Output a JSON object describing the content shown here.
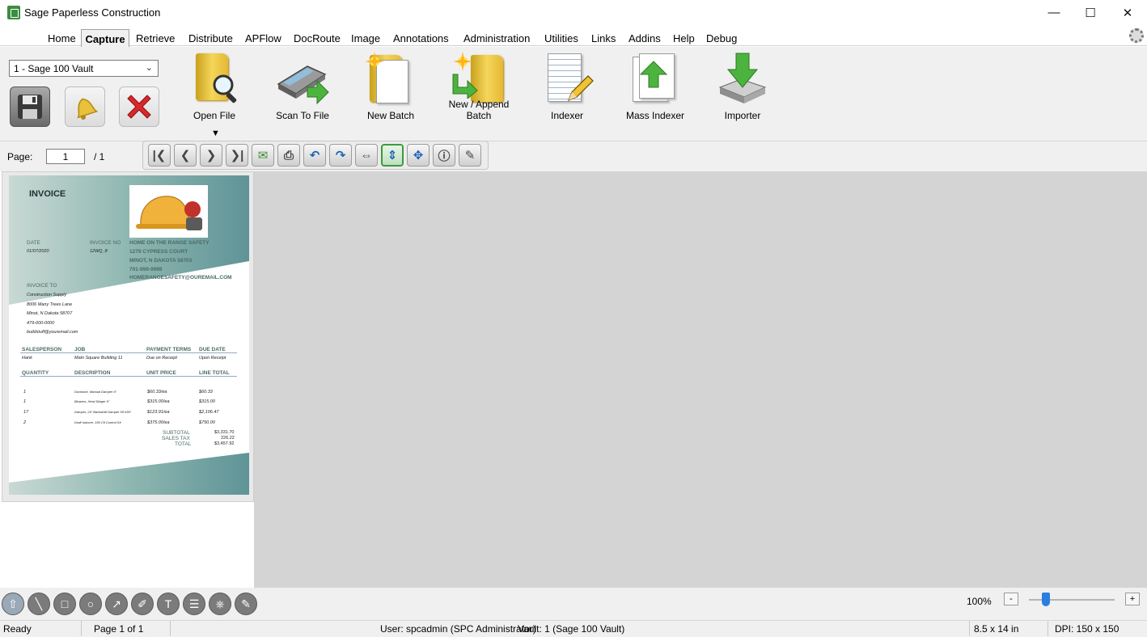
{
  "window": {
    "title": "Sage Paperless Construction",
    "minimize": "—",
    "maximize": "☐",
    "close": "✕"
  },
  "menu": [
    "Home",
    "Capture",
    "Retrieve",
    "Distribute",
    "APFlow",
    "DocRoute",
    "Image",
    "Annotations",
    "Administration",
    "Utilities",
    "Links",
    "Addins",
    "Help",
    "Debug"
  ],
  "ribbon": {
    "vault_select": "1 - Sage 100 Vault",
    "tools": {
      "open_file": "Open File",
      "scan_to_file": "Scan To File",
      "new_batch": "New Batch",
      "new_append_batch": "New / Append Batch",
      "indexer": "Indexer",
      "mass_indexer": "Mass Indexer",
      "importer": "Importer"
    },
    "dropdown_marker": "▼"
  },
  "pager": {
    "label": "Page:",
    "current": "1",
    "total": "/ 1"
  },
  "invoice": {
    "title": "INVOICE",
    "date_label": "DATE",
    "date_value": "01/07/2020",
    "invoice_no_label": "INVOICE NO",
    "invoice_no_value": "12WQ_8",
    "company": [
      "HOME ON THE RANGE SAFETY",
      "1279 CYPRESS COURT",
      "MINOT, N DAKOTA 58703",
      "701-999-9999",
      "HOMERANGESAFETY@OUREMAIL.COM"
    ],
    "invoice_to_label": "INVOICE TO",
    "bill_to": [
      "Construction Supply",
      "8006 Many Trees Lane",
      "Minot, N Dakota 58707",
      "479-000-0000",
      "buildstuff@youremail.com"
    ],
    "row1_headers": [
      "SALESPERSON",
      "JOB",
      "PAYMENT TERMS",
      "DUE DATE"
    ],
    "row1_values": [
      "Hank",
      "Main Square Building 11",
      "Due on Receipt",
      "Upon Receipt"
    ],
    "row2_headers": [
      "QUANTITY",
      "DESCRIPTION",
      "UNIT PRICE",
      "LINE TOTAL"
    ],
    "items": [
      {
        "qty": "1",
        "desc": "Ductwork, Manual Damper 6\"",
        "price": "$60.33/ea",
        "total": "$60.33"
      },
      {
        "qty": "1",
        "desc": "Blowers, Heat Slinger 5\"",
        "price": "$315.00/ea",
        "total": "$315.00"
      },
      {
        "qty": "17",
        "desc": "Damper, 24\" Backdraft Damper 55\"x55\"",
        "price": "$123.91/ea",
        "total": "$2,106.47"
      },
      {
        "qty": "2",
        "desc": "Draft Inducer, 150 Cfl Control Kit",
        "price": "$375.00/ea",
        "total": "$750.00"
      }
    ],
    "subtotal_label": "SUBTOTAL",
    "subtotal": "$3,331.70",
    "tax_label": "SALES TAX",
    "tax": "226.22",
    "total_label": "TOTAL",
    "total": "$3,457.92"
  },
  "zoom": {
    "value": "100%",
    "minus": "-",
    "plus": "+",
    "level": 0.2
  },
  "status": {
    "ready": "Ready",
    "page": "Page 1 of 1",
    "user": "User: spcadmin (SPC Administrator)",
    "vault": "Vault: 1 (Sage 100 Vault)",
    "paper": "8.5 x 14 in",
    "dpi": "DPI: 150 x 150"
  }
}
